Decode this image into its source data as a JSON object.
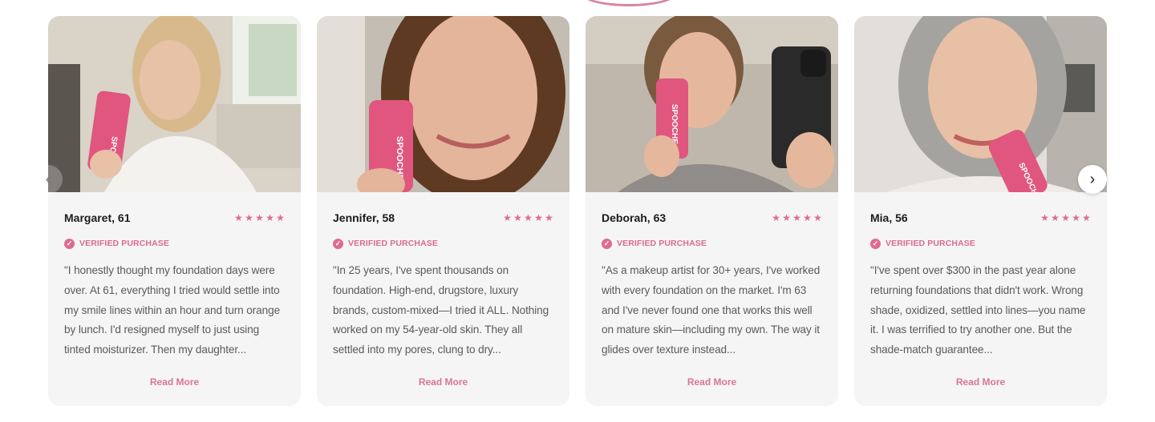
{
  "reviews": [
    {
      "name": "Margaret, 61",
      "stars": "★★★★★",
      "verified": "VERIFIED PURCHASE",
      "text": "\"I honestly thought my foundation days were over. At 61, everything I tried would settle into my smile lines within an hour and turn orange by lunch. I'd resigned myself to just using tinted moisturizer. Then my daughter...",
      "read_more": "Read More",
      "product_label": "SPOOCHE"
    },
    {
      "name": "Jennifer, 58",
      "stars": "★★★★★",
      "verified": "VERIFIED PURCHASE",
      "text": "\"In 25 years, I've spent thousands on foundation. High-end, drugstore, luxury brands, custom-mixed—I tried it ALL. Nothing worked on my 54-year-old skin. They all settled into my pores, clung to dry...",
      "read_more": "Read More",
      "product_label": "SPOOCHE"
    },
    {
      "name": "Deborah, 63",
      "stars": "★★★★★",
      "verified": "VERIFIED PURCHASE",
      "text": "\"As a makeup artist for 30+ years, I've worked with every foundation on the market. I'm 63 and I've never found one that works this well on mature skin—including my own. The way it glides over texture instead...",
      "read_more": "Read More",
      "product_label": "SPOOCHE"
    },
    {
      "name": "Mia, 56",
      "stars": "★★★★★",
      "verified": "VERIFIED PURCHASE",
      "text": "\"I've spent over $300 in the past year alone returning foundations that didn't work. Wrong shade, oxidized, settled into lines—you name it. I was terrified to try another one. But the shade-match guarantee...",
      "read_more": "Read More",
      "product_label": "SPOOCHE"
    }
  ],
  "nav": {
    "prev_icon": "chevron-left-icon",
    "next_icon": "chevron-right-icon",
    "prev_glyph": "‹",
    "next_glyph": "›"
  },
  "colors": {
    "accent": "#de6b93",
    "card_bg": "#f6f5f5",
    "product_pink": "#e0567e"
  }
}
